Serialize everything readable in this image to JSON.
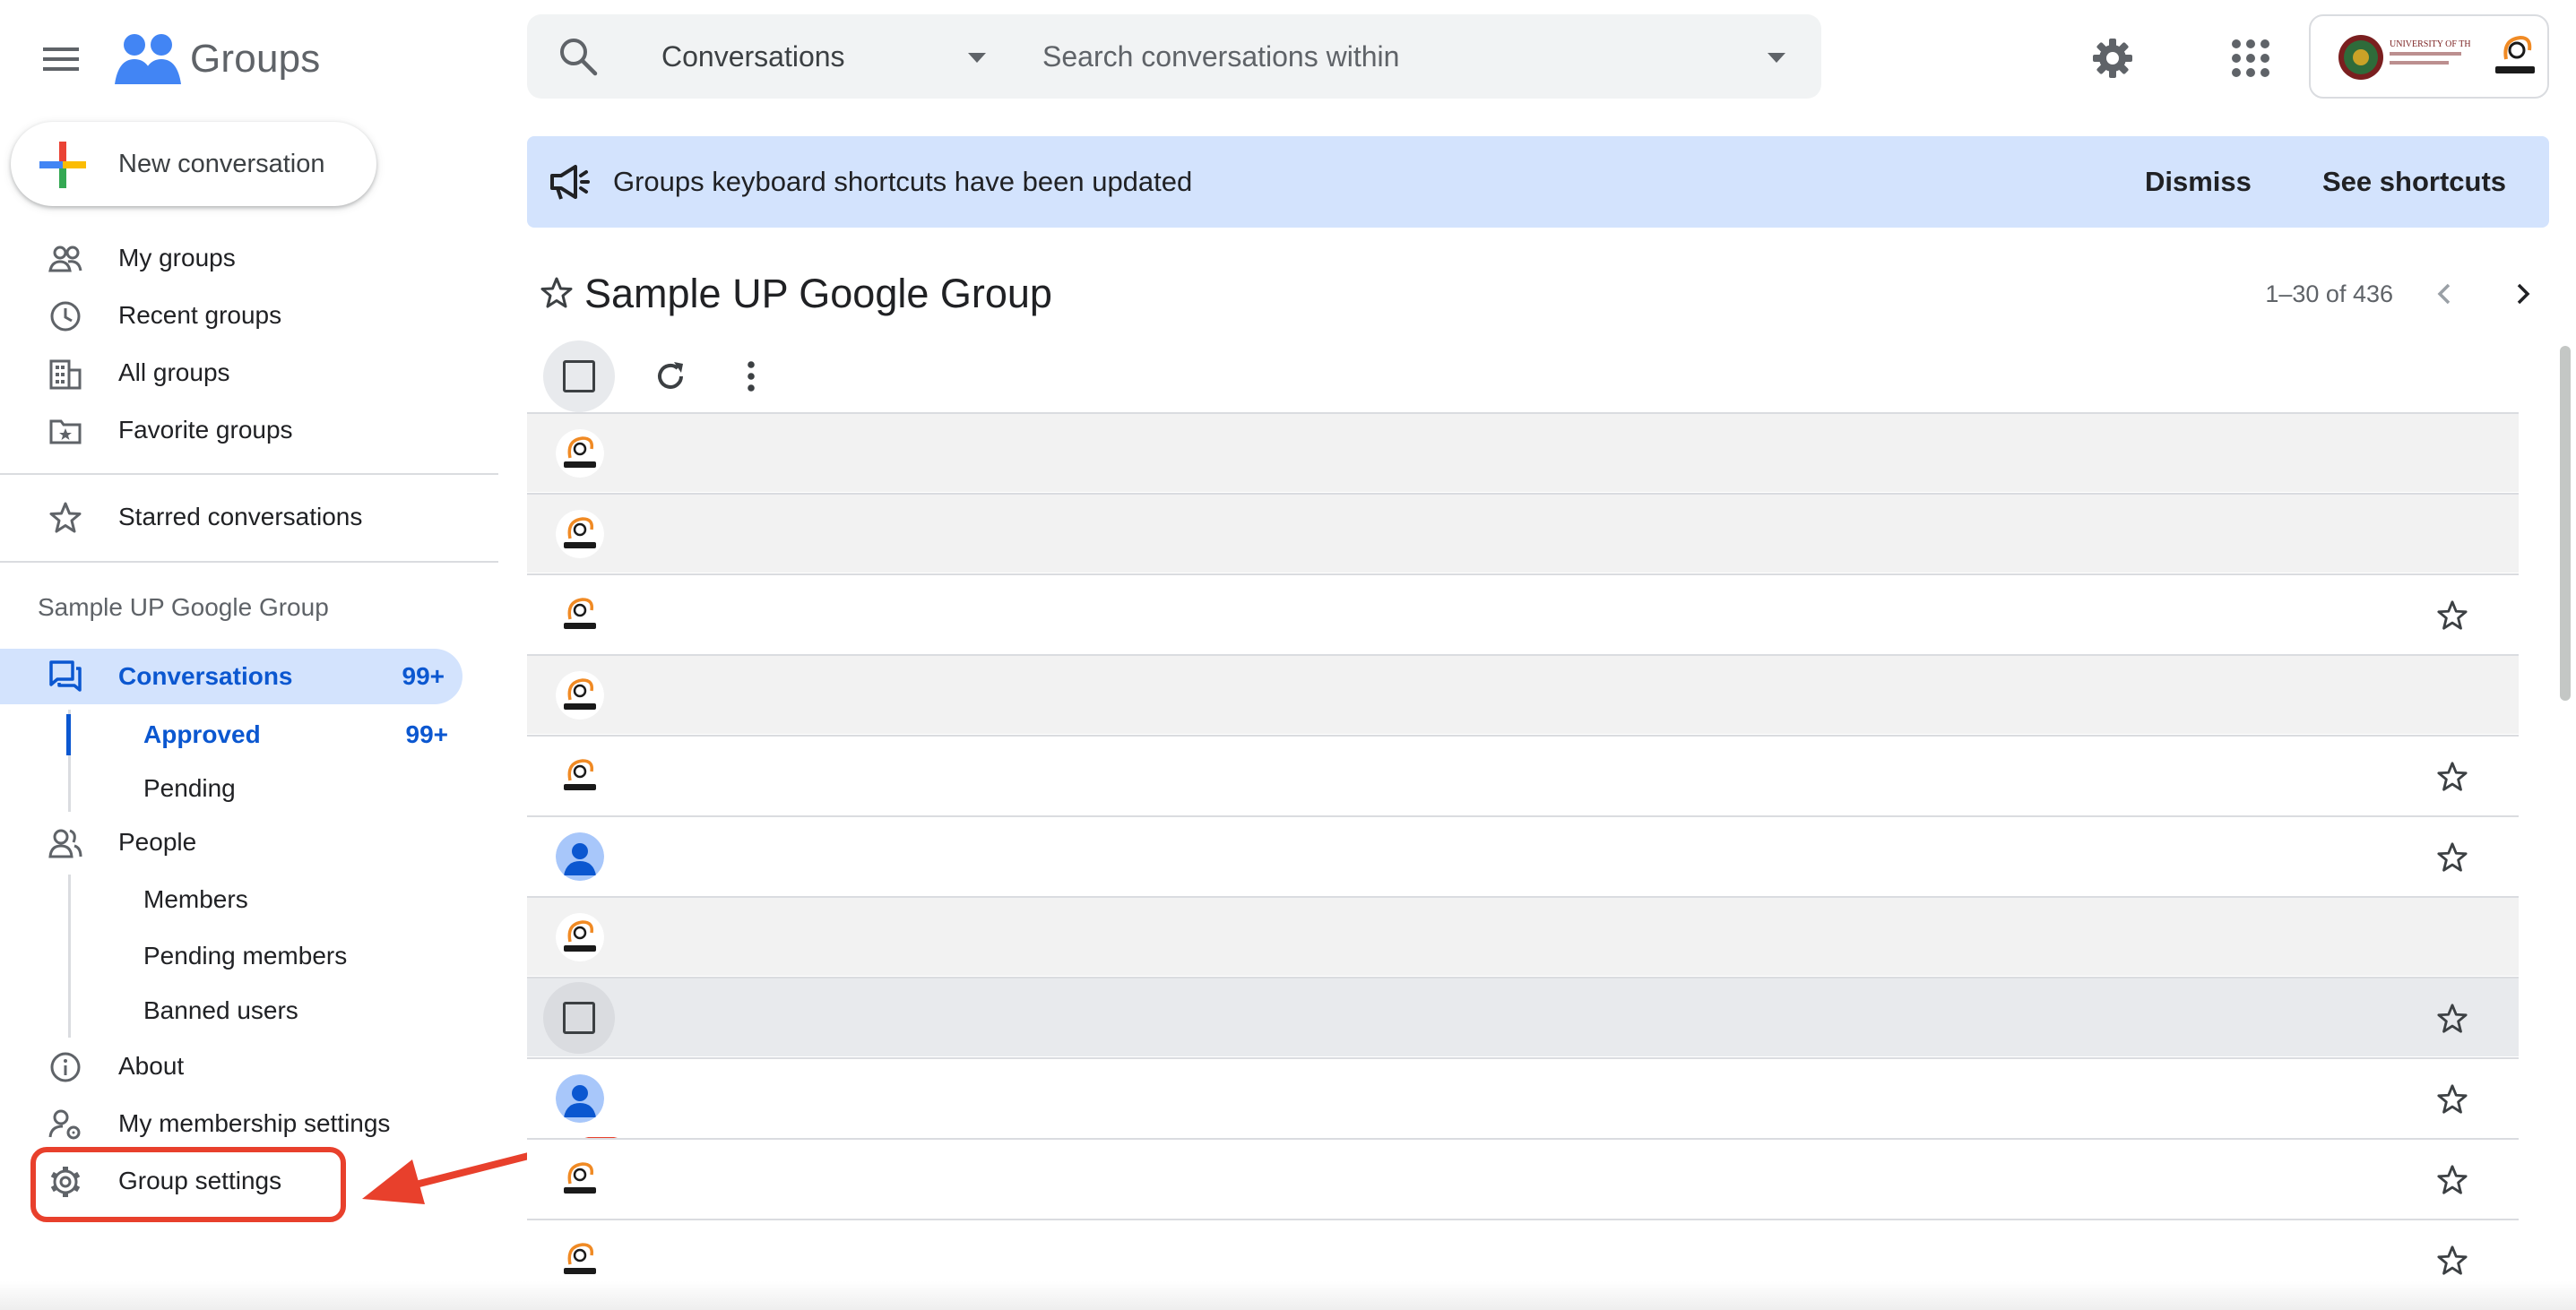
{
  "app": {
    "name": "Groups"
  },
  "header": {
    "search_scope": "Conversations",
    "search_placeholder": "Search conversations within",
    "account_logo_text": "UNIVERSITY OF THE PHILIPPINES"
  },
  "sidebar": {
    "new_conversation": "New conversation",
    "nav": [
      {
        "label": "My groups",
        "icon": "people-outline-icon"
      },
      {
        "label": "Recent groups",
        "icon": "clock-icon"
      },
      {
        "label": "All groups",
        "icon": "building-icon"
      },
      {
        "label": "Favorite groups",
        "icon": "star-folder-icon"
      }
    ],
    "starred": "Starred conversations",
    "group_name": "Sample UP Google Group",
    "conversations": {
      "label": "Conversations",
      "count": "99+"
    },
    "approved": {
      "label": "Approved",
      "count": "99+"
    },
    "pending": "Pending",
    "people": "People",
    "members": "Members",
    "pending_members": "Pending members",
    "banned_users": "Banned users",
    "about": "About",
    "membership_settings": "My membership settings",
    "group_settings": "Group settings"
  },
  "banner": {
    "message": "Groups keyboard shortcuts have been updated",
    "dismiss": "Dismiss",
    "see_shortcuts": "See shortcuts"
  },
  "main": {
    "group_title": "Sample UP Google Group",
    "pagination": "1–30 of 436"
  },
  "rows": [
    {
      "avatar": "upitdc",
      "state": "read",
      "starred_icon": false
    },
    {
      "avatar": "upitdc",
      "state": "read",
      "starred_icon": false
    },
    {
      "avatar": "upitdc",
      "state": "unread",
      "starred_icon": true
    },
    {
      "avatar": "upitdc",
      "state": "read",
      "starred_icon": false
    },
    {
      "avatar": "upitdc",
      "state": "unread",
      "starred_icon": true
    },
    {
      "avatar": "person",
      "state": "unread",
      "starred_icon": true
    },
    {
      "avatar": "upitdc",
      "state": "read",
      "starred_icon": false
    },
    {
      "avatar": "checkbox",
      "state": "hover",
      "starred_icon": true
    },
    {
      "avatar": "person",
      "state": "unread",
      "starred_icon": true
    },
    {
      "avatar": "upitdc",
      "state": "unread",
      "starred_icon": true
    },
    {
      "avatar": "upitdc",
      "state": "unread",
      "starred_icon": true
    }
  ],
  "colors": {
    "accent": "#0b57d0",
    "banner_bg": "#d3e3fd",
    "annotation": "#e8402c"
  }
}
